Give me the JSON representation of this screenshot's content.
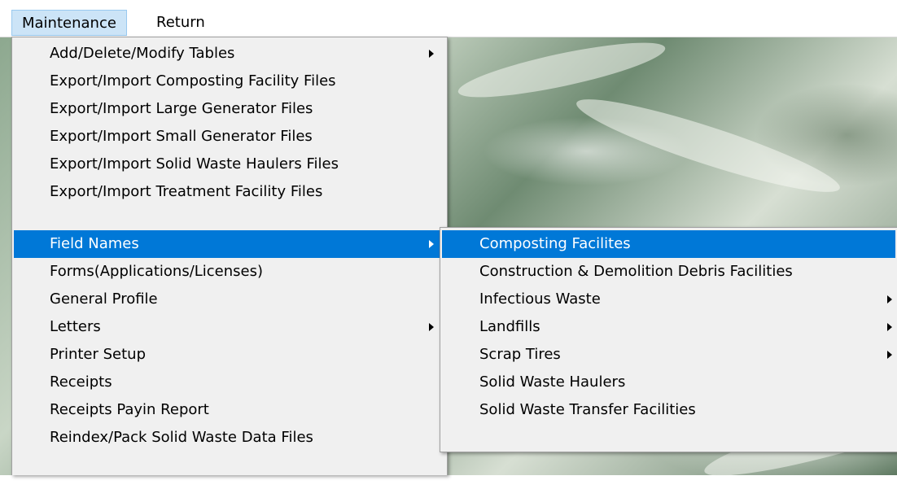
{
  "menubar": {
    "items": [
      {
        "label": "Maintenance"
      },
      {
        "label": "Return"
      }
    ]
  },
  "main_menu": {
    "items": [
      {
        "label": "Add/Delete/Modify Tables",
        "submenu": true
      },
      {
        "label": "Export/Import Composting Facility Files"
      },
      {
        "label": "Export/Import Large Generator Files"
      },
      {
        "label": "Export/Import Small Generator Files"
      },
      {
        "label": "Export/Import Solid Waste Haulers Files"
      },
      {
        "label": "Export/Import Treatment Facility Files"
      },
      {
        "label": "Field Names",
        "submenu": true,
        "highlighted": true
      },
      {
        "label": "Forms(Applications/Licenses)"
      },
      {
        "label": "General Profile"
      },
      {
        "label": "Letters",
        "submenu": true
      },
      {
        "label": "Printer Setup"
      },
      {
        "label": "Receipts"
      },
      {
        "label": "Receipts Payin Report"
      },
      {
        "label": "Reindex/Pack Solid Waste Data Files"
      }
    ]
  },
  "sub_menu": {
    "items": [
      {
        "label": "Composting Facilites",
        "highlighted": true
      },
      {
        "label": "Construction & Demolition Debris Facilities"
      },
      {
        "label": "Infectious Waste",
        "submenu": true
      },
      {
        "label": "Landfills",
        "submenu": true
      },
      {
        "label": "Scrap Tires",
        "submenu": true
      },
      {
        "label": "Solid Waste Haulers"
      },
      {
        "label": "Solid Waste Transfer Facilities"
      }
    ]
  },
  "colors": {
    "highlight": "#0078d7",
    "menubar_selected": "#cce4f7",
    "menu_background": "#f0f0f0"
  }
}
